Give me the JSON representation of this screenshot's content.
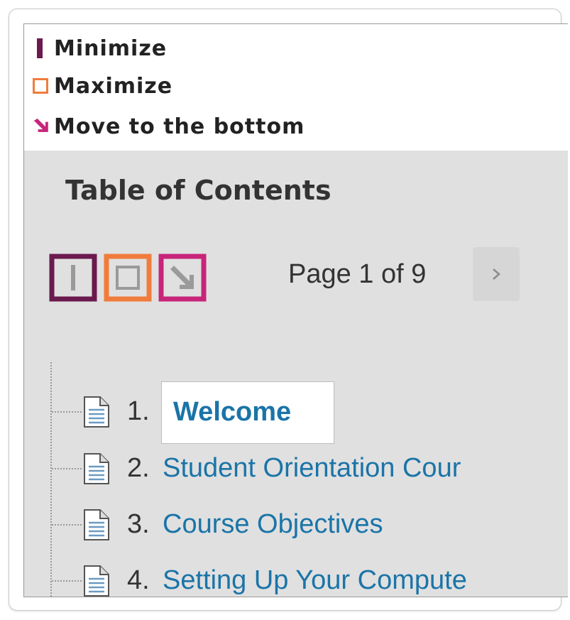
{
  "legend": {
    "items": [
      {
        "label": "Minimize",
        "icon": "minimize-icon",
        "color": "#6b1a4f"
      },
      {
        "label": "Maximize",
        "icon": "maximize-icon",
        "color": "#f07c3c"
      },
      {
        "label": "Move to the bottom",
        "icon": "move-to-bottom-icon",
        "color": "#c7257a"
      }
    ]
  },
  "toc": {
    "title": "Table of Contents",
    "controls": [
      {
        "name": "minimize",
        "icon": "minimize-icon",
        "border_color": "#6b1a4f"
      },
      {
        "name": "maximize",
        "icon": "maximize-icon",
        "border_color": "#f07c3c"
      },
      {
        "name": "move-to-bottom",
        "icon": "move-to-bottom-icon",
        "border_color": "#c7257a"
      }
    ],
    "page_indicator": "Page 1 of 9",
    "next_icon": "chevron-right-icon",
    "items": [
      {
        "number": "1.",
        "label": "Welcome",
        "icon": "document-icon",
        "current": true
      },
      {
        "number": "2.",
        "label": "Student Orientation Cour",
        "icon": "document-icon"
      },
      {
        "number": "3.",
        "label": "Course Objectives",
        "icon": "document-icon"
      },
      {
        "number": "4.",
        "label": "Setting Up Your Compute",
        "icon": "document-icon"
      }
    ],
    "link_color": "#1a74a8",
    "panel_color": "#e0e0e0"
  }
}
